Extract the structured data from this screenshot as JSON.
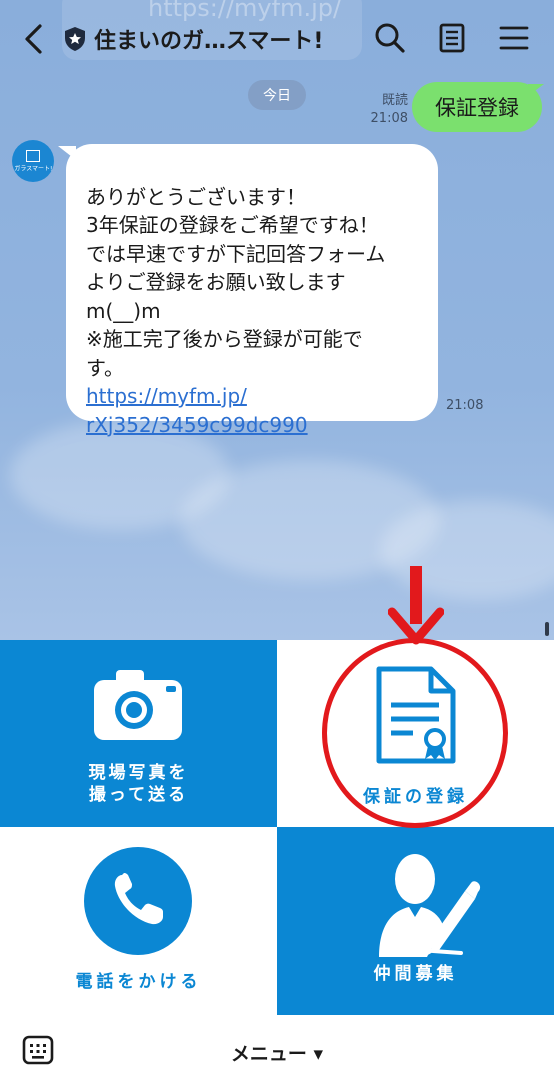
{
  "header": {
    "ghost_link": "https://myfm.jp/",
    "title": "住まいのガ…スマート!"
  },
  "chat": {
    "date_separator": "今日",
    "outgoing": {
      "text": "保証登録",
      "read_label": "既読",
      "time": "21:08"
    },
    "incoming": {
      "avatar_text": "ガラスマート!",
      "text": "ありがとうございます！\n3年保証の登録をご希望ですね！\nでは早速ですが下記回答フォーム\nよりご登録をお願い致します\nm(__)m\n※施工完了後から登録が可能で\nす。",
      "link": "https://myfm.jp/\nrXj352/3459c99dc990",
      "time": "21:08"
    }
  },
  "rich_menu": {
    "photo": "現場写真を\n撮って送る",
    "warranty": "保証の登録",
    "phone": "電話をかける",
    "recruit": "仲間募集"
  },
  "footer": {
    "menu_label": "メニュー ▾"
  },
  "colors": {
    "brand_blue": "#0b87d3",
    "annotation_red": "#e2191c",
    "bubble_green": "#7be06e"
  }
}
